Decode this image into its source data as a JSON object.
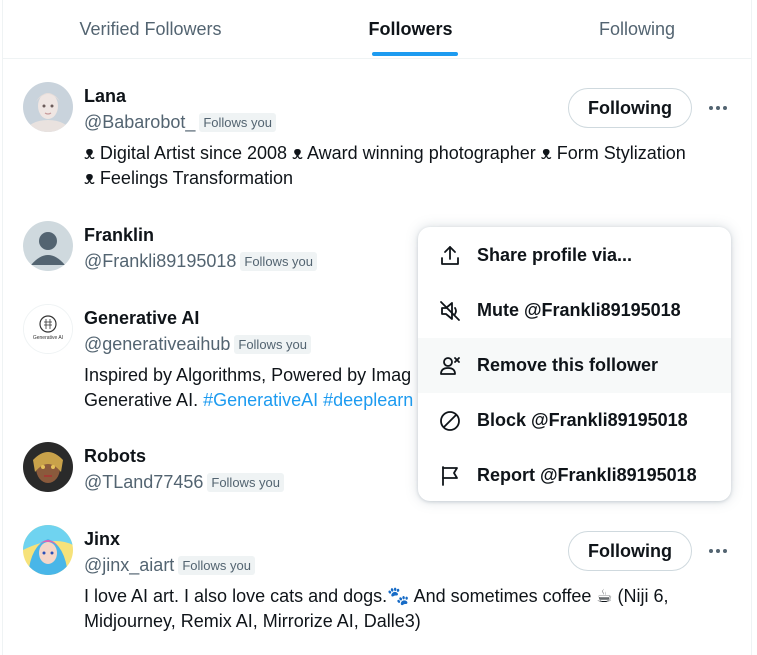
{
  "tabs": [
    {
      "label": "Verified Followers"
    },
    {
      "label": "Followers"
    },
    {
      "label": "Following"
    }
  ],
  "users": [
    {
      "name": "Lana",
      "handle": "@Babarobot_",
      "badge": "Follows you",
      "bio_line1": "ᴥ Digital Artist since 2008 ᴥ Award winning photographer ᴥ Form Stylization",
      "bio_line2": "ᴥ Feelings Transformation",
      "button": "Following"
    },
    {
      "name": "Franklin",
      "handle": "@Frankli89195018",
      "badge": "Follows you"
    },
    {
      "name": "Generative AI",
      "handle": "@generativeaihub",
      "badge": "Follows you",
      "bio_line1": "Inspired by Algorithms, Powered by Imag",
      "bio_line2_text": "Generative AI. ",
      "bio_line2_tags": "#GenerativeAI #deeplearn",
      "avatar_text": "Generative AI"
    },
    {
      "name": "Robots",
      "handle": "@TLand77456",
      "badge": "Follows you"
    },
    {
      "name": "Jinx",
      "handle": "@jinx_aiart",
      "badge": "Follows you",
      "bio_line1": "I love AI art. I also love cats and dogs.🐾 And sometimes coffee ☕ (Niji 6,",
      "bio_line2": "Midjourney, Remix AI, Mirrorize AI, Dalle3)",
      "button": "Following"
    }
  ],
  "menu": {
    "items": [
      {
        "label": "Share profile via...",
        "icon": "share-icon"
      },
      {
        "label": "Mute @Frankli89195018",
        "icon": "mute-icon"
      },
      {
        "label": "Remove this follower",
        "icon": "remove-follower-icon"
      },
      {
        "label": "Block @Frankli89195018",
        "icon": "block-icon"
      },
      {
        "label": "Report @Frankli89195018",
        "icon": "flag-icon"
      }
    ]
  },
  "colors": {
    "accent": "#1d9bf0",
    "text": "#0f1419",
    "secondary": "#536471"
  }
}
